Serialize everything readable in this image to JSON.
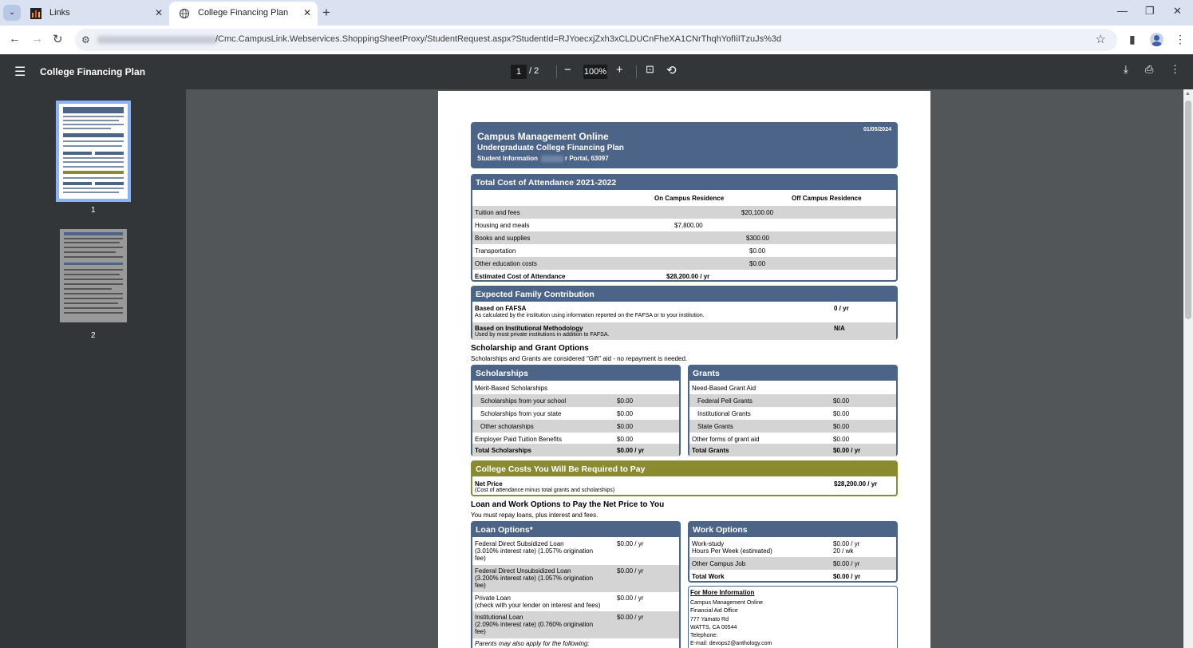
{
  "browser": {
    "tabs": [
      {
        "label": "Links"
      },
      {
        "label": "College Financing Plan"
      }
    ],
    "url": "/Cmc.CampusLink.Webservices.ShoppingSheetProxy/StudentRequest.aspx?StudentId=RJYoecxjZxh3xCLDUCnFheXA1CNrThqhYofIiITzuJs%3d"
  },
  "pdf": {
    "title": "College Financing Plan",
    "page": "1",
    "total": "/  2",
    "zoom": "100%",
    "thumbs": [
      "1",
      "2"
    ]
  },
  "doc": {
    "date": "01/05/2024",
    "school": "Campus Management Online",
    "plan": "Undergraduate College Financing Plan",
    "student_prefix": "Student Information",
    "student_suffix": "r Portal, 63097",
    "coa": {
      "title": "Total Cost of Attendance 2021-2022",
      "col1": "On Campus Residence",
      "col2": "Off Campus Residence",
      "rows": [
        {
          "label": "Tuition and fees",
          "v1": "",
          "v2": "$20,100.00"
        },
        {
          "label": "Housing and meals",
          "v1": "$7,800.00",
          "v2": ""
        },
        {
          "label": "Books and supplies",
          "v1": "",
          "v2": "$300.00"
        },
        {
          "label": "Transportation",
          "v1": "",
          "v2": "$0.00"
        },
        {
          "label": "Other education costs",
          "v1": "",
          "v2": "$0.00"
        }
      ],
      "total_label": "Estimated Cost of Attendance",
      "total_value": "$28,200.00 / yr"
    },
    "efc": {
      "title": "Expected Family Contribution",
      "r1_label": "Based on FAFSA",
      "r1_sub": "As calculated by the institution using information reported on the FAFSA or to your institution.",
      "r1_value": "0 / yr",
      "r2_label": "Based on Institutional Methodology",
      "r2_sub": "Used by most private institutions in addition to FAFSA.",
      "r2_value": "N/A"
    },
    "sg": {
      "title": "Scholarship and Grant Options",
      "sub": "Scholarships and Grants are considered \"Gift\" aid - no repayment is needed."
    },
    "scholarships": {
      "title": "Scholarships",
      "rows": [
        {
          "label": "Merit-Based Scholarships",
          "value": ""
        },
        {
          "label": "Scholarships from your school",
          "value": "$0.00"
        },
        {
          "label": "Scholarships from your state",
          "value": "$0.00"
        },
        {
          "label": "Other scholarships",
          "value": "$0.00"
        },
        {
          "label": "Employer Paid Tuition Benefits",
          "value": "$0.00"
        }
      ],
      "total_label": "Total Scholarships",
      "total_value": "$0.00 / yr"
    },
    "grants": {
      "title": "Grants",
      "rows": [
        {
          "label": "Need-Based Grant Aid",
          "value": ""
        },
        {
          "label": "Federal Pell Grants",
          "value": "$0.00"
        },
        {
          "label": "Institutional Grants",
          "value": "$0.00"
        },
        {
          "label": "State Grants",
          "value": "$0.00"
        },
        {
          "label": "Other forms of grant aid",
          "value": "$0.00"
        }
      ],
      "total_label": "Total Grants",
      "total_value": "$0.00 / yr"
    },
    "net": {
      "title": "College Costs You Will Be Required to Pay",
      "label": "Net Price",
      "sub": "(Cost of attendance minus total grants and scholarships)",
      "value": "$28,200.00 / yr"
    },
    "lw": {
      "title": "Loan and Work Options to Pay the Net Price to You",
      "sub": "You must repay loans, plus interest and fees."
    },
    "loans": {
      "title": "Loan Options*",
      "rows": [
        {
          "l1": "Federal Direct Subsidized Loan",
          "l2": "(3.010% interest rate) (1.057% origination",
          "l3": "fee)",
          "value": "$0.00 / yr"
        },
        {
          "l1": "Federal Direct Unsubsidized Loan",
          "l2": "(3.200% interest rate) (1.057% origination",
          "l3": "fee)",
          "value": "$0.00 / yr"
        },
        {
          "l1": "Private Loan",
          "l2": "(check with your lender on interest and fees)",
          "l3": "",
          "value": "$0.00 / yr"
        },
        {
          "l1": "Institutional Loan",
          "l2": "(2.090% interest rate) (0.760% origination",
          "l3": "fee)",
          "value": "$0.00 / yr"
        }
      ],
      "parents": "Parents may also apply for the following:"
    },
    "work": {
      "title": "Work Options",
      "r1_label": "Work-study",
      "r1_value": "$0.00 / yr",
      "r2_label": "Hours Per Week (estimated)",
      "r2_value": "20 / wk",
      "r3_label": "Other Campus Job",
      "r3_value": "$0.00 / yr",
      "total_label": "Total Work",
      "total_value": "$0.00 / yr"
    },
    "info": {
      "title": "For More Information",
      "lines": [
        "Campus Management Online",
        "Financial Aid Office",
        "777 Yamato Rd",
        "WATTS, CA 00544",
        "Telephone:",
        "E-mail: devops2@anthology.com"
      ]
    }
  }
}
